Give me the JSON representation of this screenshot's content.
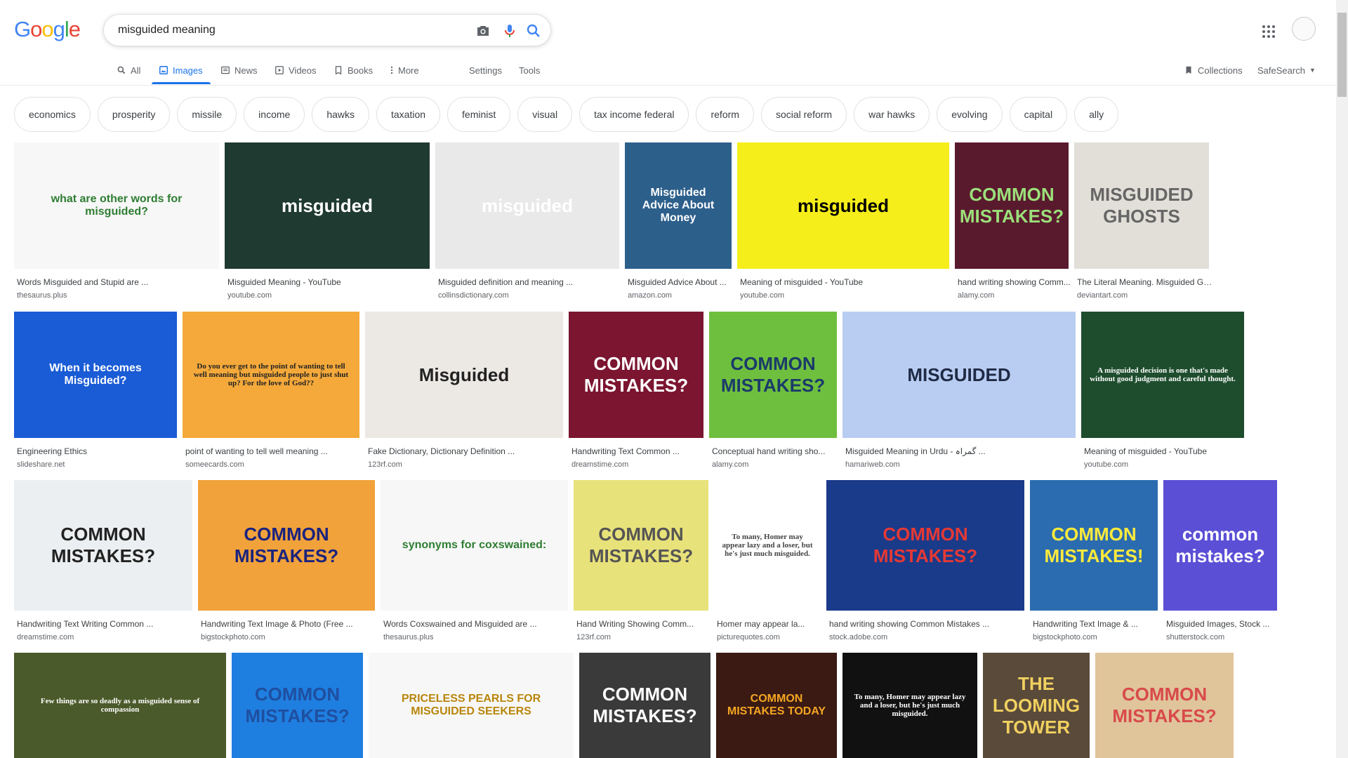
{
  "logo": {
    "letters": [
      "G",
      "o",
      "o",
      "g",
      "l",
      "e"
    ],
    "colors": [
      "#4285f4",
      "#ea4335",
      "#fbbc05",
      "#4285f4",
      "#34a853",
      "#ea4335"
    ]
  },
  "search": {
    "query": "misguided meaning"
  },
  "tabs": [
    {
      "label": "All",
      "icon": "search-icon"
    },
    {
      "label": "Images",
      "icon": "image-icon",
      "active": true
    },
    {
      "label": "News",
      "icon": "news-icon"
    },
    {
      "label": "Videos",
      "icon": "video-icon"
    },
    {
      "label": "Books",
      "icon": "book-icon"
    },
    {
      "label": "More",
      "icon": "more-vert-icon"
    },
    {
      "label": "Settings"
    },
    {
      "label": "Tools"
    }
  ],
  "right_tools": {
    "collections": "Collections",
    "safesearch": "SafeSearch"
  },
  "chips": [
    "economics",
    "prosperity",
    "missile",
    "income",
    "hawks",
    "taxation",
    "feminist",
    "visual",
    "tax income federal",
    "reform",
    "social reform",
    "war hawks",
    "evolving",
    "capital",
    "ally"
  ],
  "rows": [
    [
      {
        "caption": "Words Misguided and Stupid are ...",
        "source": "thesaurus.plus",
        "bg": "#f7f7f7",
        "text": "what are other words for misguided?",
        "fg": "#2e7d32"
      },
      {
        "caption": "Misguided Meaning - YouTube",
        "source": "youtube.com",
        "bg": "#1f3a30",
        "text": "misguided",
        "fg": "#ffffff"
      },
      {
        "caption": "Misguided definition and meaning ...",
        "source": "collinsdictionary.com",
        "bg": "#e9e9e9",
        "text": "misguided",
        "fg": "#ffffff"
      },
      {
        "caption": "Misguided Advice About ...",
        "source": "amazon.com",
        "bg": "#2d5f8b",
        "text": "Misguided Advice About Money",
        "fg": "#ffffff"
      },
      {
        "caption": "Meaning of misguided - YouTube",
        "source": "youtube.com",
        "bg": "#f5ee1a",
        "text": "misguided",
        "fg": "#000000"
      },
      {
        "caption": "hand writing showing Comm...",
        "source": "alamy.com",
        "bg": "#5a1a2e",
        "text": "COMMON MISTAKES?",
        "fg": "#9be07a"
      },
      {
        "caption": "The Literal Meaning. Misguided Gh...",
        "source": "deviantart.com",
        "bg": "#e2dfd9",
        "text": "MISGUIDED GHOSTS",
        "fg": "#666666"
      }
    ],
    [
      {
        "caption": "Engineering Ethics",
        "source": "slideshare.net",
        "bg": "#1a5bd6",
        "text": "When it becomes Misguided?",
        "fg": "#ffffff"
      },
      {
        "caption": "point of wanting to tell well meaning ...",
        "source": "someecards.com",
        "bg": "#f4a93a",
        "text": "Do you ever get to the point of wanting to tell well meaning but misguided people to just shut up? For the love of God??",
        "fg": "#222222"
      },
      {
        "caption": "Fake Dictionary, Dictionary Definition ...",
        "source": "123rf.com",
        "bg": "#ece9e4",
        "text": "Misguided",
        "fg": "#222222"
      },
      {
        "caption": "Handwriting Text Common ...",
        "source": "dreamstime.com",
        "bg": "#7b1530",
        "text": "COMMON MISTAKES?",
        "fg": "#ffffff"
      },
      {
        "caption": "Conceptual hand writing sho...",
        "source": "alamy.com",
        "bg": "#6fbf3e",
        "text": "COMMON MISTAKES?",
        "fg": "#1a3a6a"
      },
      {
        "caption": "Misguided Meaning in Urdu - گمراہ ...",
        "source": "hamariweb.com",
        "bg": "#b9cdf2",
        "text": "MISGUIDED",
        "fg": "#1f2a44"
      },
      {
        "caption": "Meaning of misguided - YouTube",
        "source": "youtube.com",
        "bg": "#1e4d2e",
        "text": "A misguided decision is one that's made without good judgment and careful thought.",
        "fg": "#ffffff"
      }
    ],
    [
      {
        "caption": "Handwriting Text Writing Common ...",
        "source": "dreamstime.com",
        "bg": "#eceff1",
        "text": "COMMON MISTAKES?",
        "fg": "#222222"
      },
      {
        "caption": "Handwriting Text Image & Photo (Free ...",
        "source": "bigstockphoto.com",
        "bg": "#f2a23a",
        "text": "COMMON MISTAKES?",
        "fg": "#1a237e"
      },
      {
        "caption": "Words Coxswained and Misguided are ...",
        "source": "thesaurus.plus",
        "bg": "#f7f7f7",
        "text": "synonyms for coxswained:",
        "fg": "#2e7d32"
      },
      {
        "caption": "Hand Writing Showing Comm...",
        "source": "123rf.com",
        "bg": "#e8e27a",
        "text": "COMMON MISTAKES?",
        "fg": "#555555"
      },
      {
        "caption": "Homer may appear la...",
        "source": "picturequotes.com",
        "bg": "#ffffff",
        "text": "To many, Homer may appear lazy and a loser, but he's just much misguided.",
        "fg": "#444444"
      },
      {
        "caption": "hand writing showing Common Mistakes ...",
        "source": "stock.adobe.com",
        "bg": "#1a3a8a",
        "text": "COMMON MISTAKES?",
        "fg": "#e53935"
      },
      {
        "caption": "Handwriting Text Image & ...",
        "source": "bigstockphoto.com",
        "bg": "#2b6cb0",
        "text": "COMMON MISTAKES!",
        "fg": "#ffeb3b"
      },
      {
        "caption": "Misguided Images, Stock ...",
        "source": "shutterstock.com",
        "bg": "#5b4fd6",
        "text": "common mistakes?",
        "fg": "#ffffff"
      }
    ],
    [
      {
        "caption": "",
        "source": "",
        "bg": "#4a5a2a",
        "text": "Few things are so deadly as a misguided sense of compassion",
        "fg": "#ffffff"
      },
      {
        "caption": "",
        "source": "",
        "bg": "#1f7fe0",
        "text": "COMMON MISTAKES?",
        "fg": "#1f4fa0"
      },
      {
        "caption": "",
        "source": "",
        "bg": "#f7f7f7",
        "text": "PRICELESS PEARLS FOR MISGUIDED SEEKERS",
        "fg": "#b8860b"
      },
      {
        "caption": "",
        "source": "",
        "bg": "#3a3a3a",
        "text": "COMMON MISTAKES?",
        "fg": "#ffffff"
      },
      {
        "caption": "",
        "source": "",
        "bg": "#3a1a12",
        "text": "COMMON MISTAKES TODAY",
        "fg": "#f5a623"
      },
      {
        "caption": "",
        "source": "",
        "bg": "#111111",
        "text": "To many, Homer may appear lazy and a loser, but he's just much misguided.",
        "fg": "#ffffff"
      },
      {
        "caption": "",
        "source": "",
        "bg": "#5a4a3a",
        "text": "THE LOOMING TOWER",
        "fg": "#f0d060"
      },
      {
        "caption": "",
        "source": "",
        "bg": "#e0c49a",
        "text": "COMMON MISTAKES?",
        "fg": "#d84a4a"
      }
    ]
  ]
}
